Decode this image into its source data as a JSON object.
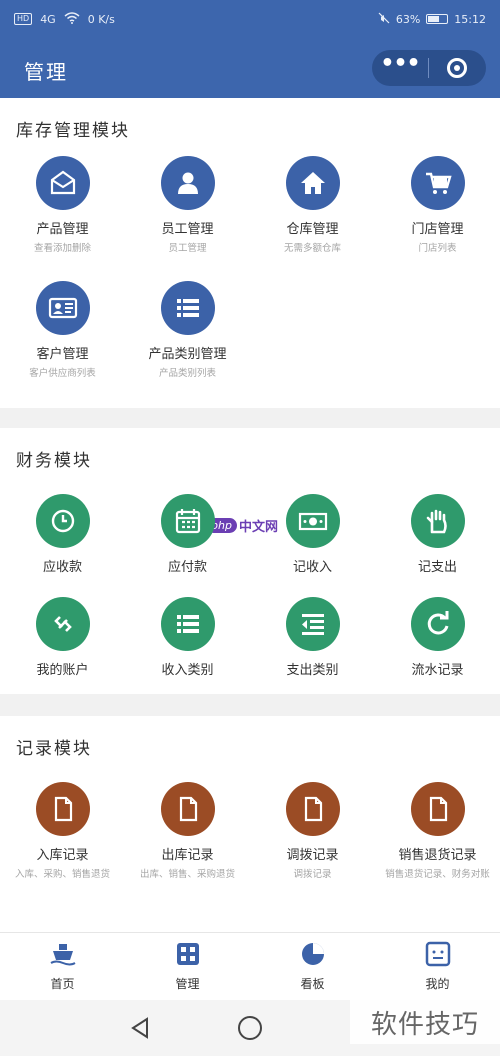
{
  "status_bar": {
    "left_badge": "HD",
    "signal": "4G",
    "speed": "0 K/s",
    "right_text": "63%",
    "time": "15:12"
  },
  "header": {
    "title": "管理",
    "menu_icon": "more-dots-icon",
    "close_icon": "target-circle-icon"
  },
  "sections": [
    {
      "title": "库存管理模块",
      "color": "#3c62a8",
      "tiles": [
        {
          "icon": "envelope-icon",
          "label": "产品管理",
          "sub": "查看添加删除"
        },
        {
          "icon": "person-icon",
          "label": "员工管理",
          "sub": "员工管理"
        },
        {
          "icon": "house-icon",
          "label": "仓库管理",
          "sub": "无需多额仓库"
        },
        {
          "icon": "cart-icon",
          "label": "门店管理",
          "sub": "门店列表"
        },
        {
          "icon": "id-card-icon",
          "label": "客户管理",
          "sub": "客户供应商列表"
        },
        {
          "icon": "list-icon",
          "label": "产品类别管理",
          "sub": "产品类别列表"
        }
      ]
    },
    {
      "title": "财务模块",
      "color": "#2f9a6c",
      "tiles": [
        {
          "icon": "clock-icon",
          "label": "应收款",
          "sub": ""
        },
        {
          "icon": "calendar-icon",
          "label": "应付款",
          "sub": ""
        },
        {
          "icon": "cash-icon",
          "label": "记收入",
          "sub": ""
        },
        {
          "icon": "hand-icon",
          "label": "记支出",
          "sub": ""
        },
        {
          "icon": "link-icon",
          "label": "我的账户",
          "sub": ""
        },
        {
          "icon": "list-icon",
          "label": "收入类别",
          "sub": ""
        },
        {
          "icon": "outdent-icon",
          "label": "支出类别",
          "sub": ""
        },
        {
          "icon": "refresh-icon",
          "label": "流水记录",
          "sub": ""
        }
      ]
    },
    {
      "title": "记录模块",
      "color": "#9b4c25",
      "tiles": [
        {
          "icon": "file-icon",
          "label": "入库记录",
          "sub": "入库、采购、销售退货"
        },
        {
          "icon": "file-icon",
          "label": "出库记录",
          "sub": "出库、销售、采购退货"
        },
        {
          "icon": "file-icon",
          "label": "调拨记录",
          "sub": "调拨记录"
        },
        {
          "icon": "file-icon",
          "label": "销售退货记录",
          "sub": "销售退货记录、财务对账"
        }
      ]
    }
  ],
  "watermark": {
    "php": "php",
    "site": "中文网",
    "bottom": "软件技巧"
  },
  "tabbar": [
    {
      "icon": "ship-icon",
      "label": "首页"
    },
    {
      "icon": "grid-icon",
      "label": "管理"
    },
    {
      "icon": "pie-chart-icon",
      "label": "看板"
    },
    {
      "icon": "face-icon",
      "label": "我的"
    }
  ],
  "colors": {
    "header": "#3d66ad",
    "finance": "#2f9a6c",
    "record": "#9b4c25",
    "stock": "#3c62a8"
  }
}
